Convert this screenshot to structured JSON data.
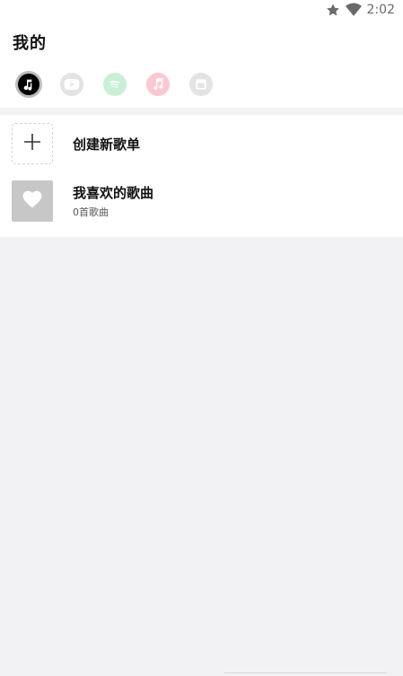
{
  "status_bar": {
    "time": "2:02",
    "icons": [
      "star-icon",
      "wifi-icon"
    ]
  },
  "header": {
    "title": "我的"
  },
  "source_tabs": [
    {
      "name": "local-music",
      "icon": "music-note-icon",
      "active": true
    },
    {
      "name": "youtube",
      "icon": "youtube-icon",
      "active": false
    },
    {
      "name": "spotify",
      "icon": "spotify-icon",
      "active": false
    },
    {
      "name": "apple-music",
      "icon": "apple-music-icon",
      "active": false
    },
    {
      "name": "other",
      "icon": "window-icon",
      "active": false
    }
  ],
  "playlists": {
    "create": {
      "label": "创建新歌单",
      "icon": "plus-icon"
    },
    "liked": {
      "title": "我喜欢的歌曲",
      "subtitle": "0首歌曲",
      "icon": "heart-icon"
    }
  },
  "colors": {
    "background": "#f2f2f4",
    "panel": "#ffffff",
    "youtube_tint": "#e3e3e3",
    "spotify_tint": "#c9f0d6",
    "apple_tint": "#fbc8d1",
    "other_tint": "#e3e3e3"
  }
}
